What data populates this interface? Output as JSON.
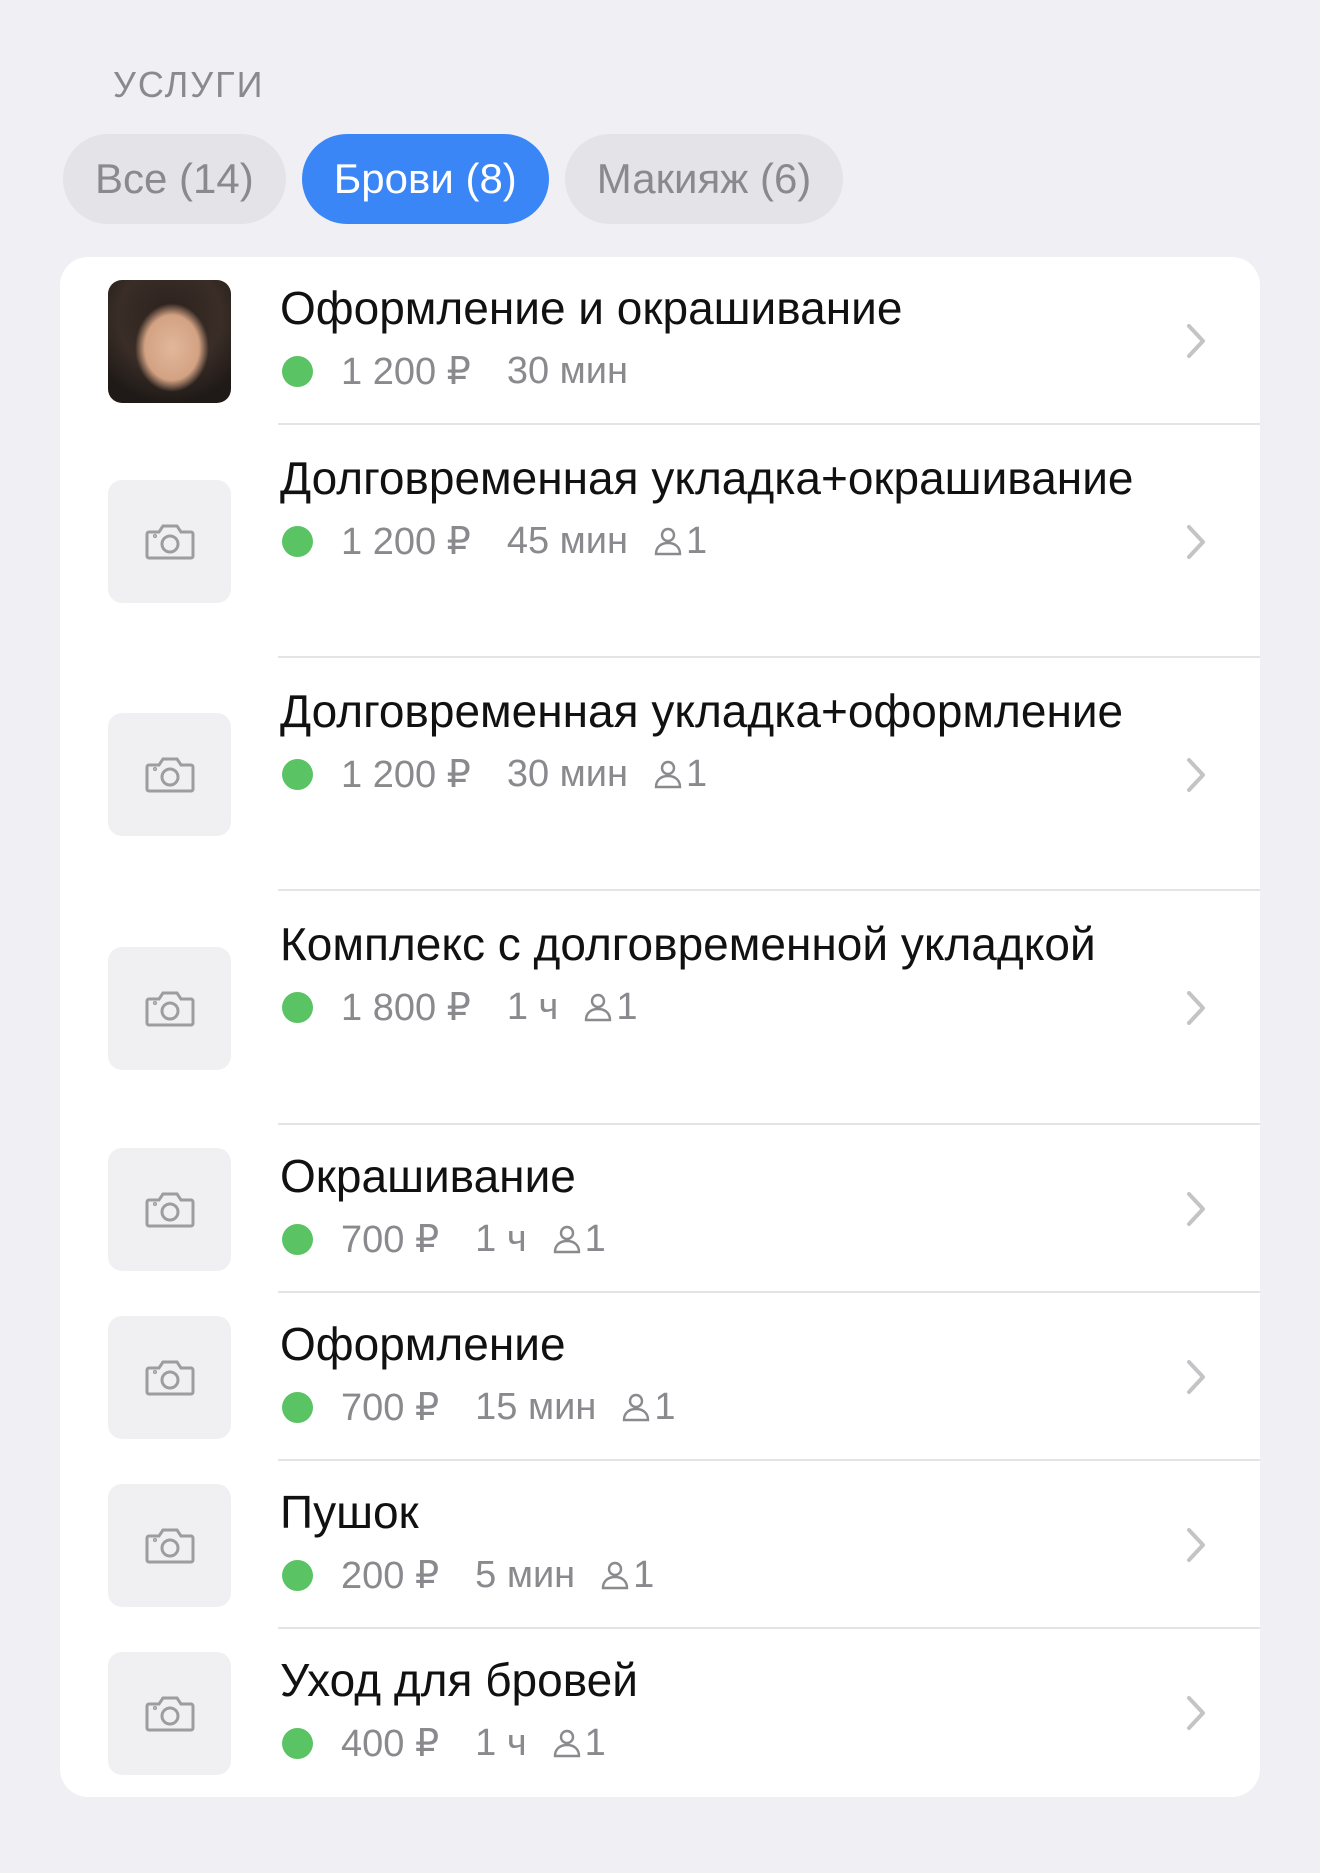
{
  "section": {
    "title": "УСЛУГИ"
  },
  "tabs": [
    {
      "label": "Все (14)",
      "active": false
    },
    {
      "label": "Брови (8)",
      "active": true
    },
    {
      "label": "Макияж (6)",
      "active": false
    }
  ],
  "colors": {
    "accent": "#3a86f7",
    "status_green": "#5ac364",
    "secondary_text": "#8a8a8e"
  },
  "services": [
    {
      "title": "Оформление и окрашивание",
      "price": "1 200 ₽",
      "duration": "30 мин",
      "staff": "",
      "thumb": "photo"
    },
    {
      "title": "Долговременная укладка+окрашивание",
      "price": "1 200 ₽",
      "duration": "45 мин",
      "staff": "1",
      "thumb": "camera-icon"
    },
    {
      "title": "Долговременная укладка+оформление",
      "price": "1 200 ₽",
      "duration": "30 мин",
      "staff": "1",
      "thumb": "camera-icon"
    },
    {
      "title": "Комплекс с долговременной укладкой",
      "price": "1 800 ₽",
      "duration": "1 ч",
      "staff": "1",
      "thumb": "camera-icon"
    },
    {
      "title": "Окрашивание",
      "price": "700 ₽",
      "duration": "1 ч",
      "staff": "1",
      "thumb": "camera-icon"
    },
    {
      "title": "Оформление",
      "price": "700 ₽",
      "duration": "15 мин",
      "staff": "1",
      "thumb": "camera-icon"
    },
    {
      "title": "Пушок",
      "price": "200 ₽",
      "duration": "5 мин",
      "staff": "1",
      "thumb": "camera-icon"
    },
    {
      "title": "Уход для бровей",
      "price": "400 ₽",
      "duration": "1 ч",
      "staff": "1",
      "thumb": "camera-icon"
    }
  ]
}
